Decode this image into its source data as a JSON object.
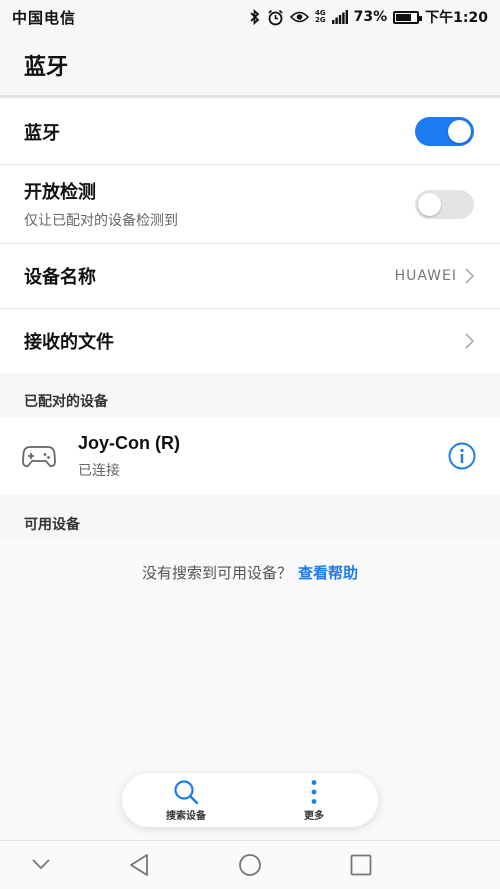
{
  "status_bar": {
    "carrier": "中国电信",
    "battery_percent": "73%",
    "battery_level": 0.73,
    "time": "下午1:20",
    "network_labels": [
      "4G",
      "2G"
    ]
  },
  "header": {
    "title": "蓝牙"
  },
  "settings": {
    "bluetooth": {
      "label": "蓝牙",
      "enabled": true
    },
    "open_detection": {
      "label": "开放检测",
      "description": "仅让已配对的设备检测到",
      "enabled": false
    },
    "device_name": {
      "label": "设备名称",
      "value": "HUAWEI"
    },
    "received_files": {
      "label": "接收的文件"
    }
  },
  "paired": {
    "section_label": "已配对的设备",
    "devices": [
      {
        "name": "Joy-Con (R)",
        "status": "已连接",
        "icon": "gamepad-icon"
      }
    ]
  },
  "available": {
    "section_label": "可用设备",
    "empty_text": "没有搜索到可用设备？",
    "help_link": "查看帮助"
  },
  "actions": {
    "search_label": "搜索设备",
    "more_label": "更多"
  },
  "colors": {
    "accent": "#1a7cf0",
    "background": "#f7f7f7",
    "card": "#ffffff"
  }
}
